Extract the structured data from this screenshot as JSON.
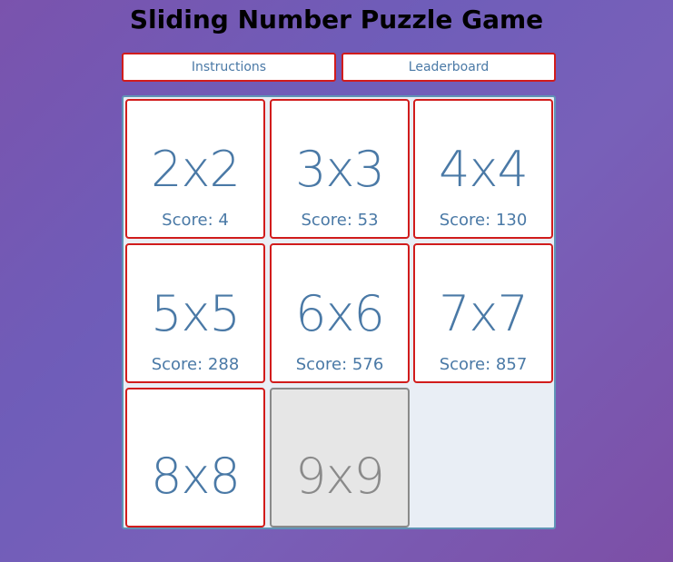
{
  "header": {
    "title": "Sliding Number Puzzle Game"
  },
  "nav": {
    "instructions_label": "Instructions",
    "leaderboard_label": "Leaderboard"
  },
  "levels": [
    {
      "size": "2x2",
      "score_text": "Score: 4"
    },
    {
      "size": "3x3",
      "score_text": "Score: 53"
    },
    {
      "size": "4x4",
      "score_text": "Score: 130"
    },
    {
      "size": "5x5",
      "score_text": "Score: 288"
    },
    {
      "size": "6x6",
      "score_text": "Score: 576"
    },
    {
      "size": "7x7",
      "score_text": "Score: 857"
    },
    {
      "size": "8x8"
    },
    {
      "size": "9x9"
    }
  ],
  "colors": {
    "accent_border": "#d11c1c",
    "text_blue": "#4a79a6",
    "locked_gray": "#8a8a8a",
    "board_border": "#5f94b6"
  }
}
